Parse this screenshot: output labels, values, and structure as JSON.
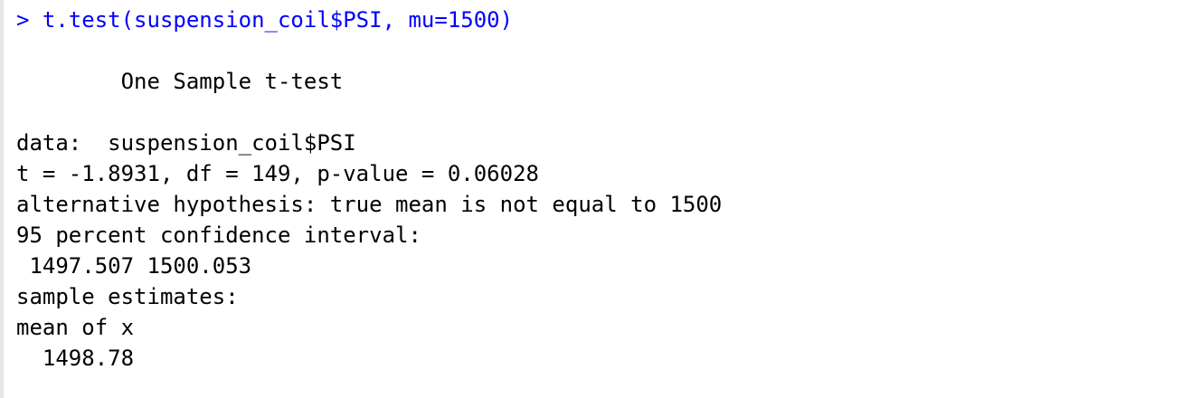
{
  "console": {
    "command": "> t.test(suspension_coil$PSI, mu=1500)",
    "output": [
      "",
      "        One Sample t-test",
      "",
      "data:  suspension_coil$PSI",
      "t = -1.8931, df = 149, p-value = 0.06028",
      "alternative hypothesis: true mean is not equal to 1500",
      "95 percent confidence interval:",
      " 1497.507 1500.053",
      "sample estimates:",
      "mean of x",
      "  1498.78"
    ]
  }
}
